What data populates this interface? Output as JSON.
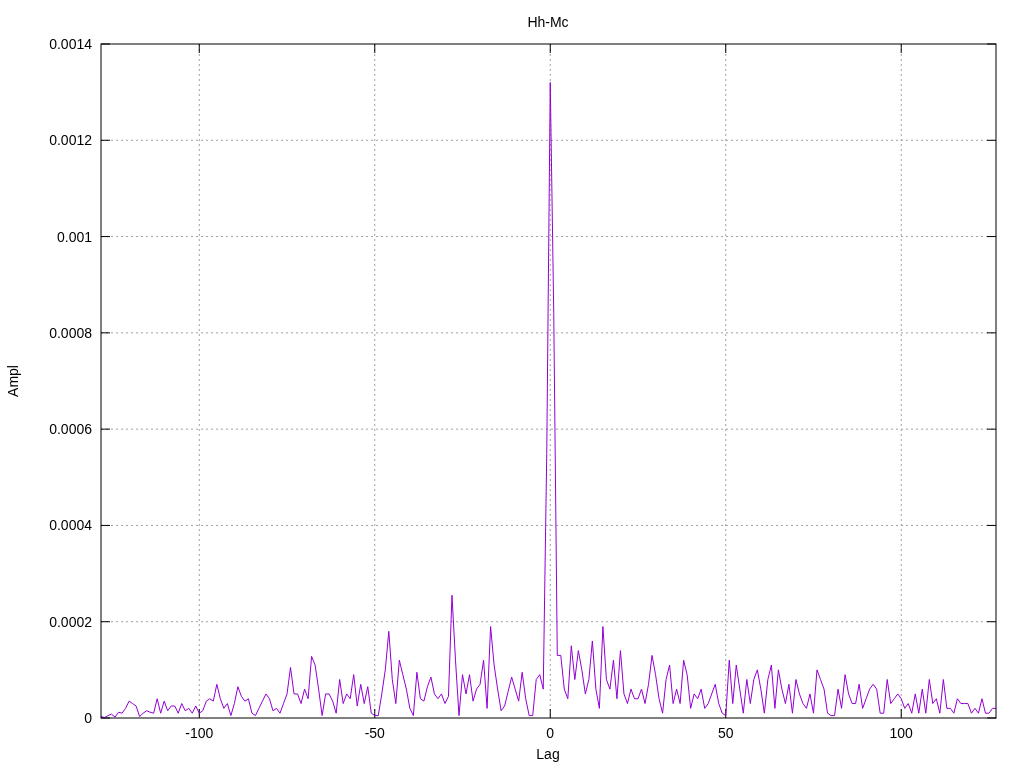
{
  "chart_data": {
    "type": "line",
    "title": "Hh-Mc",
    "xlabel": "Lag",
    "ylabel": "Ampl",
    "xlim": [
      -128,
      127
    ],
    "ylim": [
      0,
      0.0014
    ],
    "xticks": [
      -100,
      -50,
      0,
      50,
      100
    ],
    "yticks": [
      {
        "value": 0,
        "label": "0"
      },
      {
        "value": 0.0002,
        "label": "0.0002"
      },
      {
        "value": 0.0004,
        "label": "0.0004"
      },
      {
        "value": 0.0006,
        "label": "0.0006"
      },
      {
        "value": 0.0008,
        "label": "0.0008"
      },
      {
        "value": 0.001,
        "label": "0.001"
      },
      {
        "value": 0.0012,
        "label": "0.0012"
      },
      {
        "value": 0.0014,
        "label": "0.0014"
      }
    ],
    "x": [
      -128,
      -127,
      -126,
      -125,
      -124,
      -123,
      -122,
      -121,
      -120,
      -119,
      -118,
      -117,
      -116,
      -115,
      -114,
      -113,
      -112,
      -111,
      -110,
      -109,
      -108,
      -107,
      -106,
      -105,
      -104,
      -103,
      -102,
      -101,
      -100,
      -99,
      -98,
      -97,
      -96,
      -95,
      -94,
      -93,
      -92,
      -91,
      -90,
      -89,
      -88,
      -87,
      -86,
      -85,
      -84,
      -83,
      -82,
      -81,
      -80,
      -79,
      -78,
      -77,
      -76,
      -75,
      -74,
      -73,
      -72,
      -71,
      -70,
      -69,
      -68,
      -67,
      -66,
      -65,
      -64,
      -63,
      -62,
      -61,
      -60,
      -59,
      -58,
      -57,
      -56,
      -55,
      -54,
      -53,
      -52,
      -51,
      -50,
      -49,
      -48,
      -47,
      -46,
      -45,
      -44,
      -43,
      -42,
      -41,
      -40,
      -39,
      -38,
      -37,
      -36,
      -35,
      -34,
      -33,
      -32,
      -31,
      -30,
      -29,
      -28,
      -27,
      -26,
      -25,
      -24,
      -23,
      -22,
      -21,
      -20,
      -19,
      -18,
      -17,
      -16,
      -15,
      -14,
      -13,
      -12,
      -11,
      -10,
      -9,
      -8,
      -7,
      -6,
      -5,
      -4,
      -3,
      -2,
      -1,
      0,
      1,
      2,
      3,
      4,
      5,
      6,
      7,
      8,
      9,
      10,
      11,
      12,
      13,
      14,
      15,
      16,
      17,
      18,
      19,
      20,
      21,
      22,
      23,
      24,
      25,
      26,
      27,
      28,
      29,
      30,
      31,
      32,
      33,
      34,
      35,
      36,
      37,
      38,
      39,
      40,
      41,
      42,
      43,
      44,
      45,
      46,
      47,
      48,
      49,
      50,
      51,
      52,
      53,
      54,
      55,
      56,
      57,
      58,
      59,
      60,
      61,
      62,
      63,
      64,
      65,
      66,
      67,
      68,
      69,
      70,
      71,
      72,
      73,
      74,
      75,
      76,
      77,
      78,
      79,
      80,
      81,
      82,
      83,
      84,
      85,
      86,
      87,
      88,
      89,
      90,
      91,
      92,
      93,
      94,
      95,
      96,
      97,
      98,
      99,
      100,
      101,
      102,
      103,
      104,
      105,
      106,
      107,
      108,
      109,
      110,
      111,
      112,
      113,
      114,
      115,
      116,
      117,
      118,
      119,
      120,
      121,
      122,
      123,
      124,
      125,
      126,
      127
    ],
    "grid": true,
    "series": [
      {
        "color": "#9400d3",
        "values": [
          3e-06,
          1e-06,
          5e-06,
          8e-06,
          2e-06,
          1.2e-05,
          1e-05,
          2e-05,
          3.5e-05,
          3e-05,
          2.5e-05,
          3e-06,
          1e-05,
          1.5e-05,
          1.2e-05,
          1e-05,
          4e-05,
          1e-05,
          3.5e-05,
          1.5e-05,
          2.5e-05,
          2.5e-05,
          1e-05,
          3e-05,
          1.5e-05,
          2e-05,
          1e-05,
          2.5e-05,
          1e-05,
          1.5e-05,
          3.5e-05,
          4e-05,
          3.5e-05,
          7e-05,
          4e-05,
          2e-05,
          3e-05,
          5e-06,
          3e-05,
          6.5e-05,
          4.5e-05,
          3.5e-05,
          4e-05,
          1e-05,
          5e-06,
          2e-05,
          3.5e-05,
          5e-05,
          4e-05,
          1.5e-05,
          2e-05,
          1e-05,
          3e-05,
          5e-05,
          0.000105,
          5e-05,
          5e-05,
          3e-05,
          6e-05,
          4e-05,
          0.000128,
          0.00011,
          6e-05,
          5e-06,
          5e-05,
          5e-05,
          3.5e-05,
          1e-05,
          8e-05,
          3e-05,
          5e-05,
          4e-05,
          9e-05,
          2.5e-05,
          7e-05,
          3e-05,
          6.5e-05,
          1e-05,
          5e-06,
          5e-06,
          5e-05,
          0.0001,
          0.00018,
          8e-05,
          3e-05,
          0.00012,
          9e-05,
          6e-05,
          2e-05,
          5e-06,
          9.5e-05,
          4e-05,
          3.5e-05,
          6.5e-05,
          8.5e-05,
          5e-05,
          4e-05,
          5e-05,
          3e-05,
          4.5e-05,
          0.000255,
          0.00012,
          5e-06,
          9e-05,
          5e-05,
          9e-05,
          3.5e-05,
          6e-05,
          7e-05,
          0.00012,
          2e-05,
          0.00019,
          0.00011,
          6e-05,
          1.5e-05,
          2.5e-05,
          5.5e-05,
          8.5e-05,
          6e-05,
          3.5e-05,
          9.5e-05,
          4e-05,
          5e-06,
          5e-06,
          8e-05,
          9e-05,
          6e-05,
          0.00055,
          0.00132,
          0.00084,
          0.00013,
          0.00013,
          6e-05,
          4e-05,
          0.00015,
          8e-05,
          0.00014,
          0.0001,
          5e-05,
          8e-05,
          0.00016,
          6e-05,
          2e-05,
          0.00019,
          8e-05,
          6e-05,
          0.00012,
          4e-05,
          0.00014,
          5e-05,
          3e-05,
          6e-05,
          4e-05,
          4e-05,
          6e-05,
          3e-05,
          7e-05,
          0.00013,
          9e-05,
          4e-05,
          1e-05,
          8e-05,
          0.00011,
          3e-05,
          6e-05,
          3e-05,
          0.00012,
          9e-05,
          2e-05,
          5e-05,
          4e-05,
          6e-05,
          2e-05,
          3e-05,
          5e-05,
          7e-05,
          3e-05,
          1e-05,
          5e-06,
          0.00012,
          3e-05,
          0.00011,
          6e-05,
          1e-05,
          8e-05,
          3e-05,
          8e-05,
          0.0001,
          6e-05,
          1e-05,
          8e-05,
          0.00011,
          2e-05,
          0.0001,
          6e-05,
          3e-05,
          7e-05,
          1e-05,
          8e-05,
          5e-05,
          3e-05,
          2e-05,
          5e-05,
          1e-05,
          0.0001,
          8e-05,
          6e-05,
          1e-05,
          5e-06,
          5e-06,
          6e-05,
          2e-05,
          9e-05,
          5e-05,
          3e-05,
          3e-05,
          7e-05,
          2e-05,
          4e-05,
          6e-05,
          7e-05,
          6e-05,
          1e-05,
          1e-05,
          8e-05,
          3e-05,
          4e-05,
          5e-05,
          4e-05,
          2e-05,
          3e-05,
          1e-05,
          5e-05,
          1e-05,
          6e-05,
          1e-05,
          8e-05,
          3e-05,
          4e-05,
          1e-05,
          8e-05,
          2e-05,
          2e-05,
          1e-05,
          4e-05,
          3e-05,
          3e-05,
          3e-05,
          1e-05,
          2e-05,
          1e-05,
          4e-05,
          1e-05,
          1e-05,
          2e-05,
          2e-05
        ]
      }
    ]
  }
}
